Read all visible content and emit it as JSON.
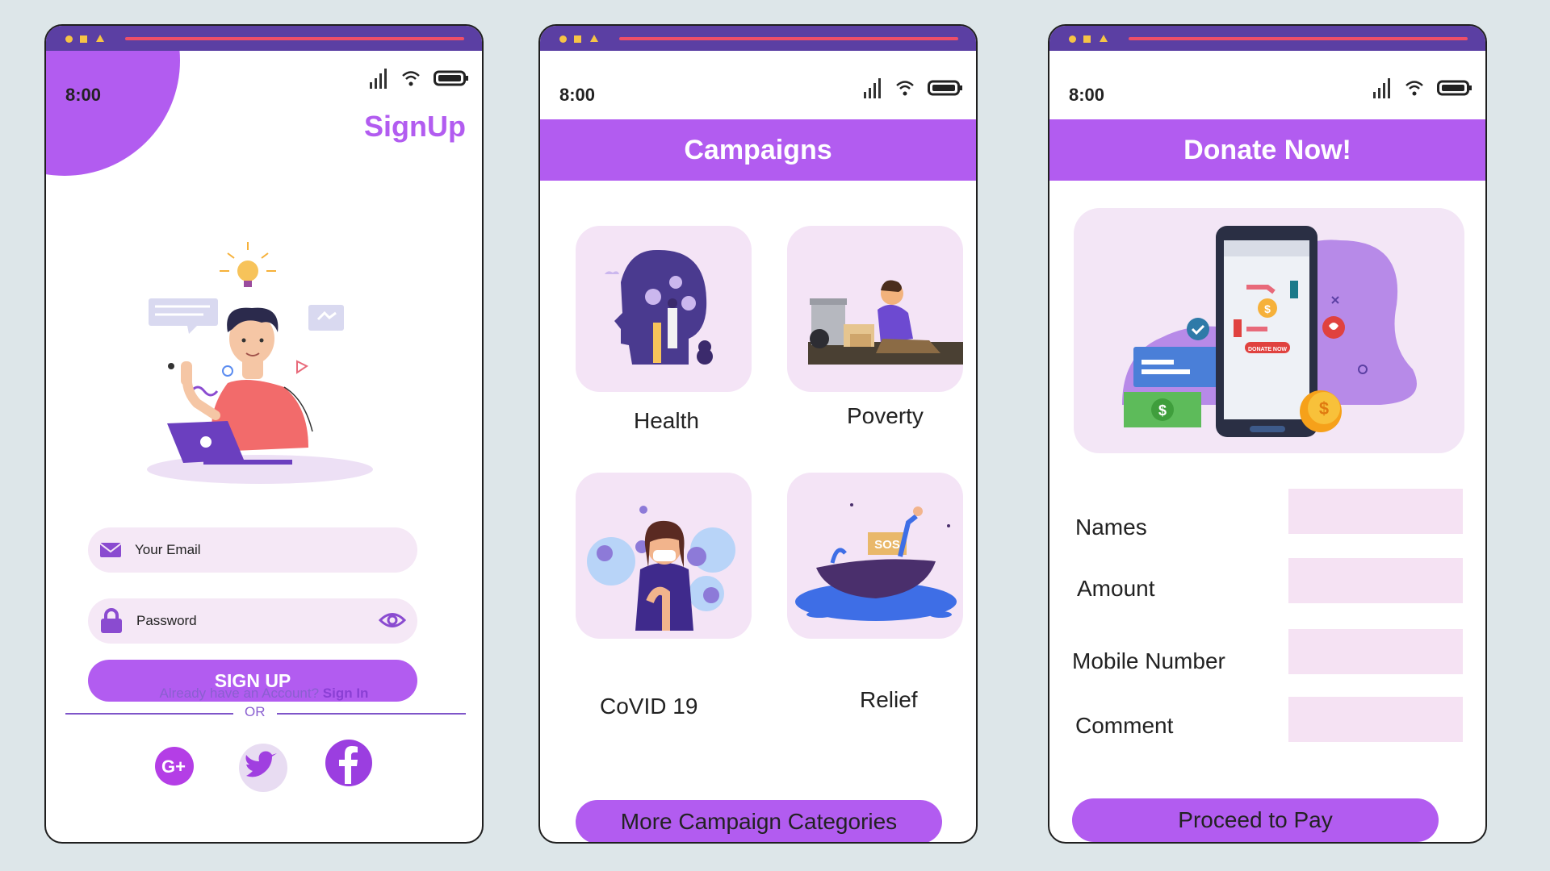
{
  "status": {
    "time": "8:00"
  },
  "signup": {
    "title": "SignUp",
    "email_placeholder": "Your Email",
    "password_placeholder": "Password",
    "button": "SIGN UP",
    "already_text": "Already have an Account? ",
    "sign_in": "Sign In",
    "or": "OR",
    "social": [
      "google-plus-icon",
      "twitter-icon",
      "facebook-icon"
    ]
  },
  "campaigns": {
    "title": "Campaigns",
    "categories": [
      {
        "label": "Health"
      },
      {
        "label": "Poverty"
      },
      {
        "label": "CoVID 19"
      },
      {
        "label": "Relief"
      }
    ],
    "more_button": "More Campaign Categories"
  },
  "donate": {
    "title": "Donate Now!",
    "fields": [
      {
        "label": "Names"
      },
      {
        "label": "Amount"
      },
      {
        "label": "Mobile Number"
      },
      {
        "label": "Comment"
      }
    ],
    "phone_badge": "DONATE NOW",
    "proceed_button": "Proceed to Pay"
  },
  "colors": {
    "accent": "#b25cf0",
    "topbar": "#5b3fa3",
    "card_bg": "#f4e4f6",
    "background": "#dde6e9"
  }
}
